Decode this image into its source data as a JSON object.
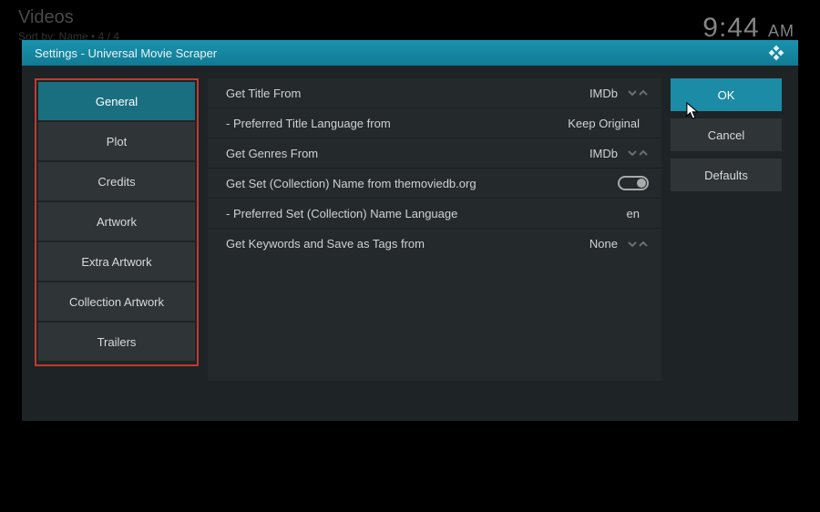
{
  "background": {
    "title": "Videos",
    "sort": "Sort by: Name  •  4 / 4",
    "clock_time": "9:44",
    "clock_ampm": "AM"
  },
  "dialog": {
    "title": "Settings - Universal Movie Scraper"
  },
  "categories": [
    {
      "label": "General",
      "selected": true
    },
    {
      "label": "Plot",
      "selected": false
    },
    {
      "label": "Credits",
      "selected": false
    },
    {
      "label": "Artwork",
      "selected": false
    },
    {
      "label": "Extra Artwork",
      "selected": false
    },
    {
      "label": "Collection Artwork",
      "selected": false
    },
    {
      "label": "Trailers",
      "selected": false
    }
  ],
  "settings": [
    {
      "label": "Get Title From",
      "value": "IMDb",
      "type": "spinner",
      "sub": false
    },
    {
      "label": "- Preferred Title Language from",
      "value": "Keep Original",
      "type": "text",
      "sub": true
    },
    {
      "label": "Get Genres From",
      "value": "IMDb",
      "type": "spinner",
      "sub": false
    },
    {
      "label": "Get Set (Collection) Name from themoviedb.org",
      "value": "",
      "type": "toggle",
      "toggle_on": true,
      "sub": false
    },
    {
      "label": "- Preferred Set (Collection) Name Language",
      "value": "en",
      "type": "text",
      "sub": true
    },
    {
      "label": "Get Keywords and Save as Tags from",
      "value": "None",
      "type": "spinner",
      "sub": false
    }
  ],
  "actions": {
    "ok": "OK",
    "cancel": "Cancel",
    "defaults": "Defaults"
  }
}
